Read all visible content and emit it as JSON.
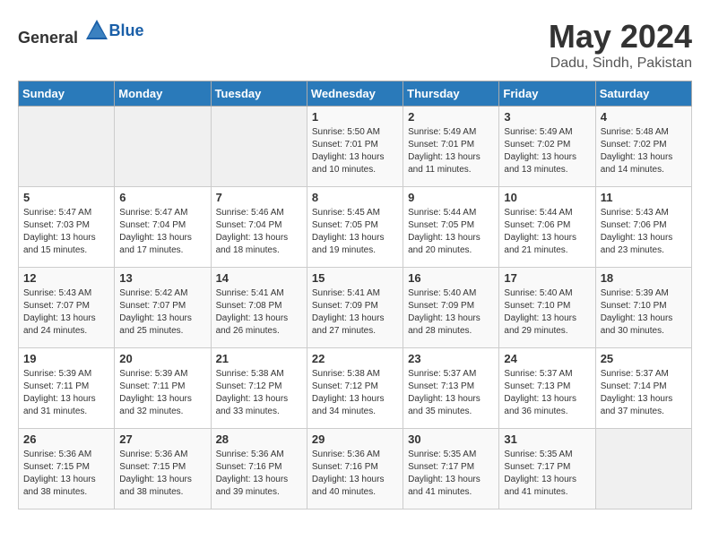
{
  "header": {
    "logo_general": "General",
    "logo_blue": "Blue",
    "month": "May 2024",
    "location": "Dadu, Sindh, Pakistan"
  },
  "weekdays": [
    "Sunday",
    "Monday",
    "Tuesday",
    "Wednesday",
    "Thursday",
    "Friday",
    "Saturday"
  ],
  "weeks": [
    [
      {
        "day": "",
        "info": []
      },
      {
        "day": "",
        "info": []
      },
      {
        "day": "",
        "info": []
      },
      {
        "day": "1",
        "info": [
          "Sunrise: 5:50 AM",
          "Sunset: 7:01 PM",
          "Daylight: 13 hours",
          "and 10 minutes."
        ]
      },
      {
        "day": "2",
        "info": [
          "Sunrise: 5:49 AM",
          "Sunset: 7:01 PM",
          "Daylight: 13 hours",
          "and 11 minutes."
        ]
      },
      {
        "day": "3",
        "info": [
          "Sunrise: 5:49 AM",
          "Sunset: 7:02 PM",
          "Daylight: 13 hours",
          "and 13 minutes."
        ]
      },
      {
        "day": "4",
        "info": [
          "Sunrise: 5:48 AM",
          "Sunset: 7:02 PM",
          "Daylight: 13 hours",
          "and 14 minutes."
        ]
      }
    ],
    [
      {
        "day": "5",
        "info": [
          "Sunrise: 5:47 AM",
          "Sunset: 7:03 PM",
          "Daylight: 13 hours",
          "and 15 minutes."
        ]
      },
      {
        "day": "6",
        "info": [
          "Sunrise: 5:47 AM",
          "Sunset: 7:04 PM",
          "Daylight: 13 hours",
          "and 17 minutes."
        ]
      },
      {
        "day": "7",
        "info": [
          "Sunrise: 5:46 AM",
          "Sunset: 7:04 PM",
          "Daylight: 13 hours",
          "and 18 minutes."
        ]
      },
      {
        "day": "8",
        "info": [
          "Sunrise: 5:45 AM",
          "Sunset: 7:05 PM",
          "Daylight: 13 hours",
          "and 19 minutes."
        ]
      },
      {
        "day": "9",
        "info": [
          "Sunrise: 5:44 AM",
          "Sunset: 7:05 PM",
          "Daylight: 13 hours",
          "and 20 minutes."
        ]
      },
      {
        "day": "10",
        "info": [
          "Sunrise: 5:44 AM",
          "Sunset: 7:06 PM",
          "Daylight: 13 hours",
          "and 21 minutes."
        ]
      },
      {
        "day": "11",
        "info": [
          "Sunrise: 5:43 AM",
          "Sunset: 7:06 PM",
          "Daylight: 13 hours",
          "and 23 minutes."
        ]
      }
    ],
    [
      {
        "day": "12",
        "info": [
          "Sunrise: 5:43 AM",
          "Sunset: 7:07 PM",
          "Daylight: 13 hours",
          "and 24 minutes."
        ]
      },
      {
        "day": "13",
        "info": [
          "Sunrise: 5:42 AM",
          "Sunset: 7:07 PM",
          "Daylight: 13 hours",
          "and 25 minutes."
        ]
      },
      {
        "day": "14",
        "info": [
          "Sunrise: 5:41 AM",
          "Sunset: 7:08 PM",
          "Daylight: 13 hours",
          "and 26 minutes."
        ]
      },
      {
        "day": "15",
        "info": [
          "Sunrise: 5:41 AM",
          "Sunset: 7:09 PM",
          "Daylight: 13 hours",
          "and 27 minutes."
        ]
      },
      {
        "day": "16",
        "info": [
          "Sunrise: 5:40 AM",
          "Sunset: 7:09 PM",
          "Daylight: 13 hours",
          "and 28 minutes."
        ]
      },
      {
        "day": "17",
        "info": [
          "Sunrise: 5:40 AM",
          "Sunset: 7:10 PM",
          "Daylight: 13 hours",
          "and 29 minutes."
        ]
      },
      {
        "day": "18",
        "info": [
          "Sunrise: 5:39 AM",
          "Sunset: 7:10 PM",
          "Daylight: 13 hours",
          "and 30 minutes."
        ]
      }
    ],
    [
      {
        "day": "19",
        "info": [
          "Sunrise: 5:39 AM",
          "Sunset: 7:11 PM",
          "Daylight: 13 hours",
          "and 31 minutes."
        ]
      },
      {
        "day": "20",
        "info": [
          "Sunrise: 5:39 AM",
          "Sunset: 7:11 PM",
          "Daylight: 13 hours",
          "and 32 minutes."
        ]
      },
      {
        "day": "21",
        "info": [
          "Sunrise: 5:38 AM",
          "Sunset: 7:12 PM",
          "Daylight: 13 hours",
          "and 33 minutes."
        ]
      },
      {
        "day": "22",
        "info": [
          "Sunrise: 5:38 AM",
          "Sunset: 7:12 PM",
          "Daylight: 13 hours",
          "and 34 minutes."
        ]
      },
      {
        "day": "23",
        "info": [
          "Sunrise: 5:37 AM",
          "Sunset: 7:13 PM",
          "Daylight: 13 hours",
          "and 35 minutes."
        ]
      },
      {
        "day": "24",
        "info": [
          "Sunrise: 5:37 AM",
          "Sunset: 7:13 PM",
          "Daylight: 13 hours",
          "and 36 minutes."
        ]
      },
      {
        "day": "25",
        "info": [
          "Sunrise: 5:37 AM",
          "Sunset: 7:14 PM",
          "Daylight: 13 hours",
          "and 37 minutes."
        ]
      }
    ],
    [
      {
        "day": "26",
        "info": [
          "Sunrise: 5:36 AM",
          "Sunset: 7:15 PM",
          "Daylight: 13 hours",
          "and 38 minutes."
        ]
      },
      {
        "day": "27",
        "info": [
          "Sunrise: 5:36 AM",
          "Sunset: 7:15 PM",
          "Daylight: 13 hours",
          "and 38 minutes."
        ]
      },
      {
        "day": "28",
        "info": [
          "Sunrise: 5:36 AM",
          "Sunset: 7:16 PM",
          "Daylight: 13 hours",
          "and 39 minutes."
        ]
      },
      {
        "day": "29",
        "info": [
          "Sunrise: 5:36 AM",
          "Sunset: 7:16 PM",
          "Daylight: 13 hours",
          "and 40 minutes."
        ]
      },
      {
        "day": "30",
        "info": [
          "Sunrise: 5:35 AM",
          "Sunset: 7:17 PM",
          "Daylight: 13 hours",
          "and 41 minutes."
        ]
      },
      {
        "day": "31",
        "info": [
          "Sunrise: 5:35 AM",
          "Sunset: 7:17 PM",
          "Daylight: 13 hours",
          "and 41 minutes."
        ]
      },
      {
        "day": "",
        "info": []
      }
    ]
  ]
}
